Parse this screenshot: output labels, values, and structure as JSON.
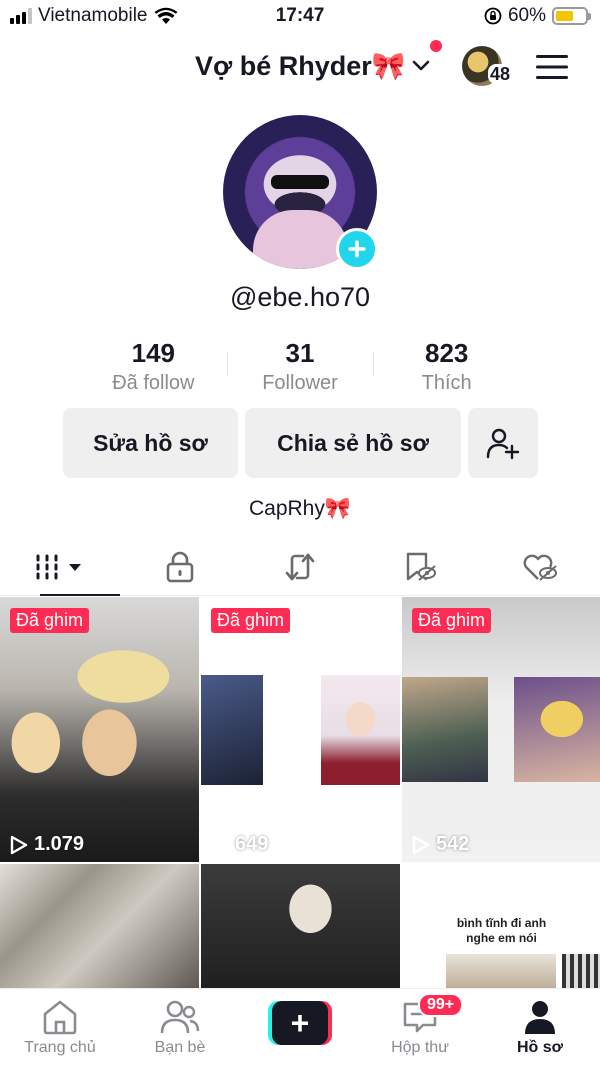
{
  "status_bar": {
    "carrier": "Vietnamobile",
    "time": "17:47",
    "battery_text": "60%",
    "battery_level": 0.6,
    "icons": [
      "signal-icon",
      "wifi-icon",
      "orientation-lock-icon",
      "battery-icon"
    ]
  },
  "header": {
    "username": "Vợ bé Rhyder🎀",
    "switch_account_icon": "chevron-down-icon",
    "has_notification_dot": true,
    "notification_dot_color": "#fe2c55",
    "friends_count": "48",
    "menu_icon": "hamburger-icon"
  },
  "profile": {
    "handle": "@ebe.ho70",
    "add_photo_icon": "plus-icon",
    "stats": [
      {
        "value": "149",
        "label": "Đã follow"
      },
      {
        "value": "31",
        "label": "Follower"
      },
      {
        "value": "823",
        "label": "Thích"
      }
    ],
    "edit_button": "Sửa hồ sơ",
    "share_button": "Chia sẻ hồ sơ",
    "add_friend_icon": "add-user-icon",
    "bio": "CapRhy🎀"
  },
  "tabs": [
    {
      "icon": "videos-grid-icon",
      "active": true
    },
    {
      "icon": "lock-icon",
      "active": false
    },
    {
      "icon": "repost-icon",
      "active": false
    },
    {
      "icon": "saved-hidden-icon",
      "active": false
    },
    {
      "icon": "liked-hidden-icon",
      "active": false
    }
  ],
  "videos": [
    {
      "pinned_label": "Đã ghim",
      "views": "1.079"
    },
    {
      "pinned_label": "Đã ghim",
      "views": "649"
    },
    {
      "pinned_label": "Đã ghim",
      "views": "542"
    },
    {
      "pinned_label": "",
      "views": ""
    },
    {
      "pinned_label": "",
      "views": ""
    },
    {
      "pinned_label": "",
      "views": "",
      "caption_line1": "bình tĩnh đi anh",
      "caption_line2": "nghe em nói"
    }
  ],
  "bottom_nav": {
    "home": "Trang chủ",
    "friends": "Bạn bè",
    "create": "+",
    "inbox": "Hộp thư",
    "inbox_badge": "99+",
    "profile": "Hồ sơ"
  },
  "colors": {
    "accent_red": "#fe2c55",
    "accent_cyan": "#20d5ec",
    "text_primary": "#161823",
    "text_secondary": "#8a8b91",
    "button_bg": "#efefef"
  }
}
